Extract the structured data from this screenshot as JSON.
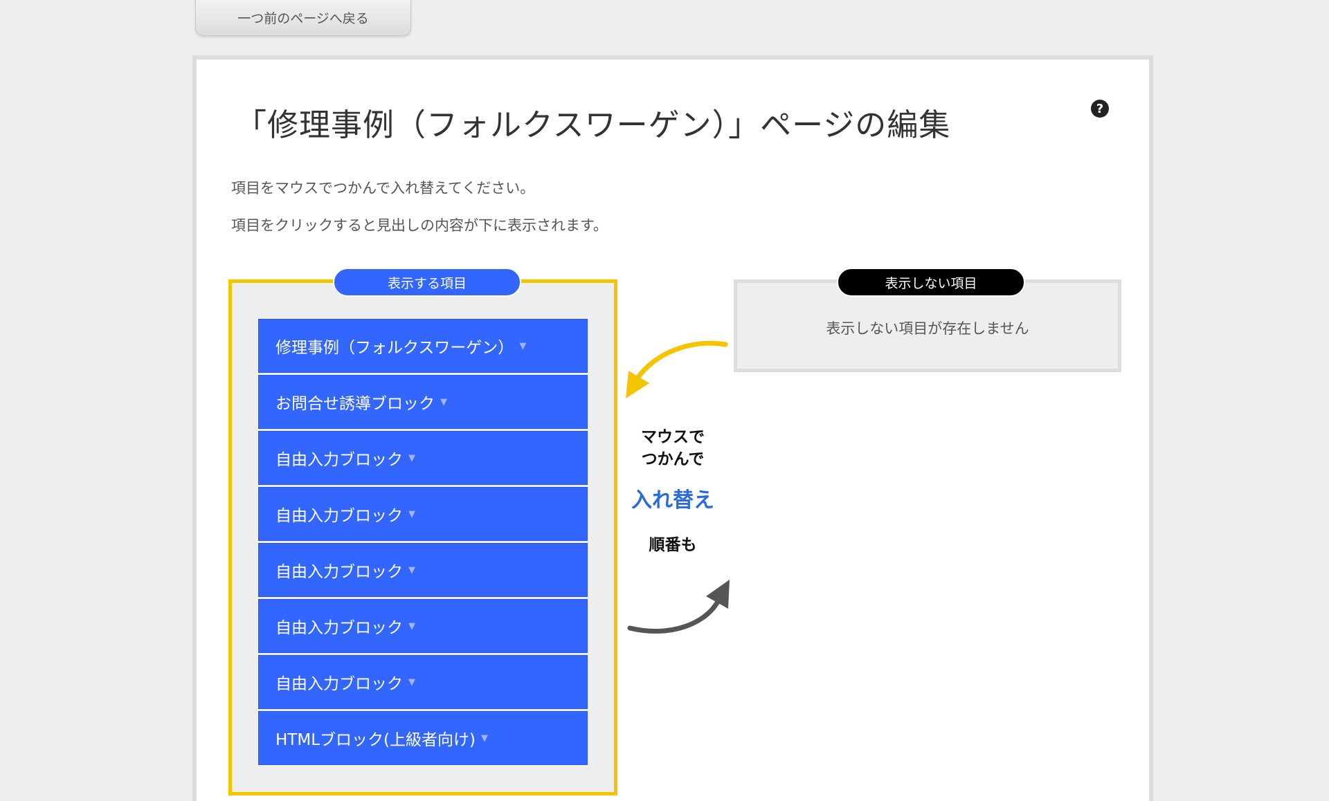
{
  "back_button": {
    "label": "一つ前のページへ戻る"
  },
  "title": "「修理事例（フォルクスワーゲン）」ページの編集",
  "help_icon": "?",
  "instructions": [
    "項目をマウスでつかんで入れ替えてください。",
    "項目をクリックすると見出しの内容が下に表示されます。"
  ],
  "shown_section": {
    "label": "表示する項目",
    "items": [
      {
        "label": "修理事例（フォルクスワーゲン）"
      },
      {
        "label": "お問合せ誘導ブロック"
      },
      {
        "label": "自由入力ブロック"
      },
      {
        "label": "自由入力ブロック"
      },
      {
        "label": "自由入力ブロック"
      },
      {
        "label": "自由入力ブロック"
      },
      {
        "label": "自由入力ブロック"
      },
      {
        "label": "HTMLブロック(上級者向け)"
      }
    ]
  },
  "hidden_section": {
    "label": "表示しない項目",
    "empty_text": "表示しない項目が存在しません"
  },
  "hint": {
    "line1": "マウスで",
    "line2": "つかんで",
    "line3": "入れ替え",
    "line4": "順番も"
  },
  "colors": {
    "accent_blue": "#3366ff",
    "frame_yellow": "#f5c400",
    "hint_blue": "#2a6bdc",
    "arrow_yellow": "#f5c400",
    "arrow_gray": "#555555"
  },
  "icons": {
    "dropdown": "chevron-down-icon",
    "help": "help-icon",
    "arrow_top": "curved-arrow-left-icon",
    "arrow_bottom": "curved-arrow-right-icon"
  }
}
